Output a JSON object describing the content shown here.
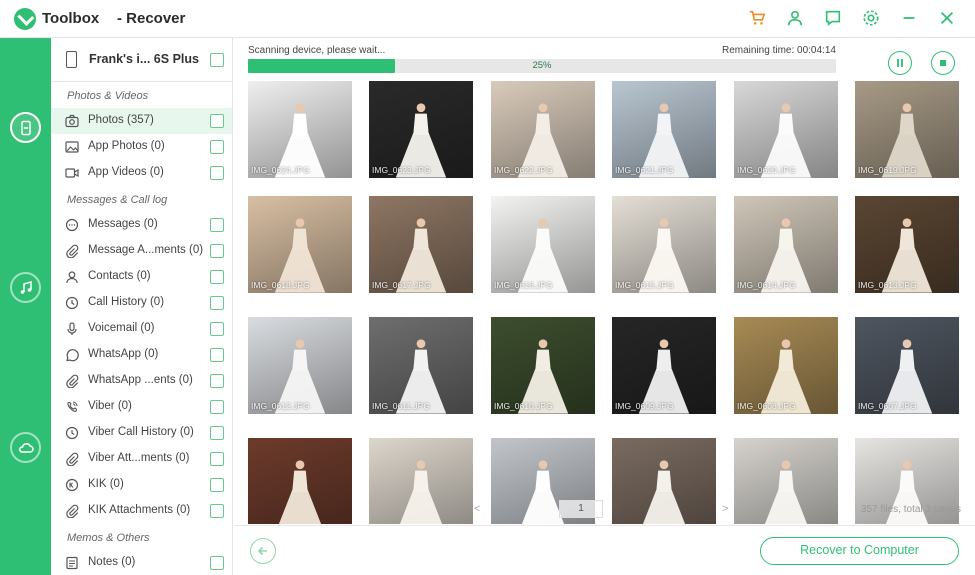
{
  "app": {
    "name": "Toolbox",
    "section": "- Recover"
  },
  "titlebar_icons": [
    "cart-icon",
    "user-icon",
    "feedback-icon",
    "settings-icon",
    "minimize-icon",
    "close-icon"
  ],
  "colors": {
    "accent": "#2fbf74",
    "cart": "#f08a24"
  },
  "device": {
    "name": "Frank's i... 6S Plus"
  },
  "sidebar": {
    "sections": [
      {
        "title": "Photos & Videos",
        "items": [
          {
            "label": "Photos (357)",
            "icon": "camera-icon",
            "active": true
          },
          {
            "label": "App Photos (0)",
            "icon": "image-icon"
          },
          {
            "label": "App Videos (0)",
            "icon": "video-icon"
          }
        ]
      },
      {
        "title": "Messages & Call log",
        "items": [
          {
            "label": "Messages (0)",
            "icon": "message-icon"
          },
          {
            "label": "Message A...ments (0)",
            "icon": "attachment-icon"
          },
          {
            "label": "Contacts (0)",
            "icon": "contact-icon"
          },
          {
            "label": "Call History (0)",
            "icon": "clock-icon"
          },
          {
            "label": "Voicemail (0)",
            "icon": "microphone-icon"
          },
          {
            "label": "WhatsApp (0)",
            "icon": "whatsapp-icon"
          },
          {
            "label": "WhatsApp ...ents (0)",
            "icon": "attachment-icon"
          },
          {
            "label": "Viber (0)",
            "icon": "viber-icon"
          },
          {
            "label": "Viber Call History (0)",
            "icon": "clock-icon"
          },
          {
            "label": "Viber Att...ments (0)",
            "icon": "attachment-icon"
          },
          {
            "label": "KIK (0)",
            "icon": "kik-icon"
          },
          {
            "label": "KIK Attachments (0)",
            "icon": "attachment-icon"
          }
        ]
      },
      {
        "title": "Memos & Others",
        "items": [
          {
            "label": "Notes (0)",
            "icon": "notes-icon"
          }
        ]
      }
    ]
  },
  "scan": {
    "status": "Scanning device, please wait...",
    "remaining": "Remaining time: 00:04:14",
    "percent_label": "25%",
    "progress": 0.25
  },
  "photos": [
    {
      "name": "IMG_0624.JPG",
      "bg": "#efefef",
      "dress": "#ffffff"
    },
    {
      "name": "IMG_0623.JPG",
      "bg": "#2a2a2a",
      "dress": "#f4f1ec"
    },
    {
      "name": "IMG_0622.JPG",
      "bg": "#d9cbbb",
      "dress": "#f3ede6"
    },
    {
      "name": "IMG_0621.JPG",
      "bg": "#b9c6d1",
      "dress": "#f2f4f6"
    },
    {
      "name": "IMG_0620.JPG",
      "bg": "#d8d8d8",
      "dress": "#fbfbfb"
    },
    {
      "name": "IMG_0619.JPG",
      "bg": "#a79a86",
      "dress": "#ded6c8"
    },
    {
      "name": "IMG_0618.JPG",
      "bg": "#d8bfa3",
      "dress": "#efe3d4"
    },
    {
      "name": "IMG_0617.JPG",
      "bg": "#8e7663",
      "dress": "#efe6da"
    },
    {
      "name": "IMG_0616.JPG",
      "bg": "#f3f3f1",
      "dress": "#fbfbfa"
    },
    {
      "name": "IMG_0615.JPG",
      "bg": "#e4ded5",
      "dress": "#fbf8f3"
    },
    {
      "name": "IMG_0614.JPG",
      "bg": "#cfc6b8",
      "dress": "#f7f4ee"
    },
    {
      "name": "IMG_0613.JPG",
      "bg": "#5b4633",
      "dress": "#efe5d8"
    },
    {
      "name": "IMG_0612.JPG",
      "bg": "#d9dce0",
      "dress": "#f5f5f5"
    },
    {
      "name": "IMG_0611.JPG",
      "bg": "#6e6e6e",
      "dress": "#f2f2f2"
    },
    {
      "name": "IMG_0610.JPG",
      "bg": "#3d4e2e",
      "dress": "#f1ede4"
    },
    {
      "name": "IMG_0609.JPG",
      "bg": "#262626",
      "dress": "#eeeeee"
    },
    {
      "name": "IMG_0608.JPG",
      "bg": "#a88b55",
      "dress": "#f2ead8"
    },
    {
      "name": "IMG_0607.JPG",
      "bg": "#4f5660",
      "dress": "#eef0f2"
    },
    {
      "name": "",
      "bg": "#6d3b2c",
      "dress": "#efe5d6"
    },
    {
      "name": "",
      "bg": "#ddd6cc",
      "dress": "#f6f1ea"
    },
    {
      "name": "",
      "bg": "#c2c6cb",
      "dress": "#ffffff"
    },
    {
      "name": "",
      "bg": "#7a6b60",
      "dress": "#f4f0ea"
    },
    {
      "name": "",
      "bg": "#d6d3ce",
      "dress": "#f8f6f2"
    },
    {
      "name": "",
      "bg": "#e7e5e2",
      "dress": "#fbfaf8"
    }
  ],
  "pager": {
    "page": "1",
    "prev": "<",
    "next": ">"
  },
  "files_info": "357 files, total 3 pages",
  "buttons": {
    "recover": "Recover to Computer"
  }
}
